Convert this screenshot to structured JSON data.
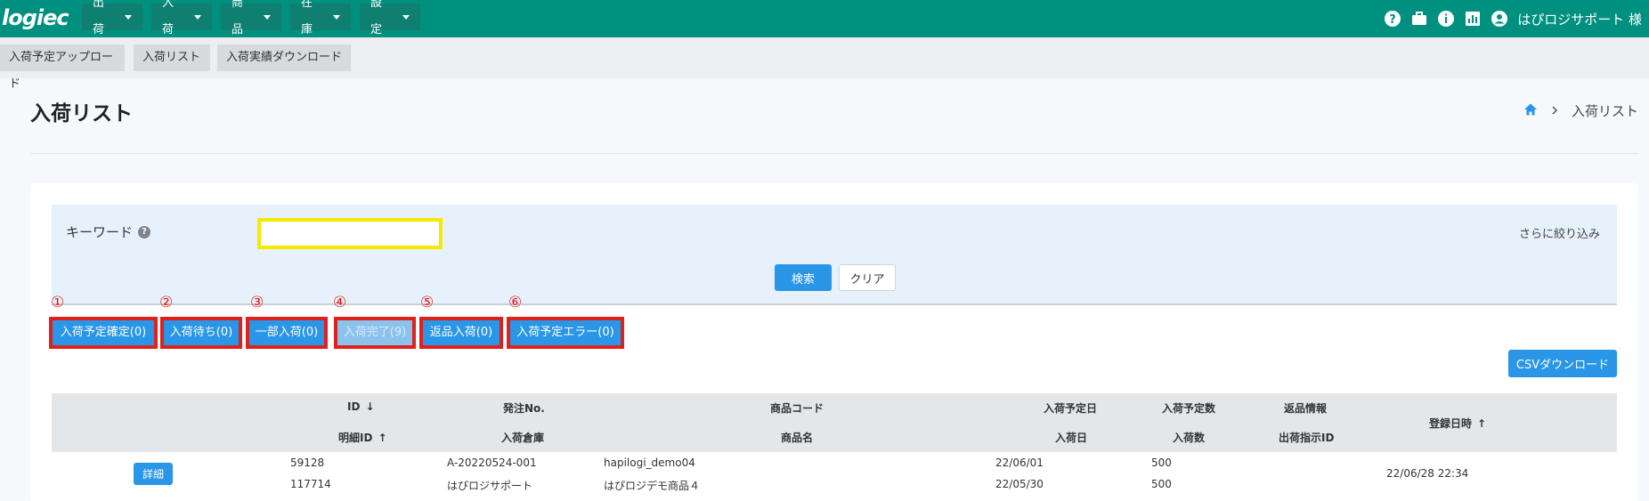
{
  "header": {
    "logo": "logiec",
    "menus": [
      {
        "label": "出荷"
      },
      {
        "label": "入荷"
      },
      {
        "label": "商品"
      },
      {
        "label": "在庫"
      },
      {
        "label": "設定"
      }
    ],
    "user": "はぴロジサポート 様",
    "icons": [
      "help-icon",
      "briefcase-icon",
      "info-icon",
      "chart-icon",
      "account-icon"
    ]
  },
  "subnav": {
    "tabs": [
      {
        "label": "入荷予定アップロード"
      },
      {
        "label": "入荷リスト"
      },
      {
        "label": "入荷実績ダウンロード"
      }
    ]
  },
  "page": {
    "title": "入荷リスト",
    "breadcrumb": "入荷リスト"
  },
  "search": {
    "keyword_label": "キーワード",
    "keyword_value": "",
    "more_filters": "さらに絞り込み",
    "search_button": "検索",
    "clear_button": "クリア"
  },
  "status_filters": [
    {
      "num": "①",
      "label": "入荷予定確定(0)"
    },
    {
      "num": "②",
      "label": "入荷待ち(0)"
    },
    {
      "num": "③",
      "label": "一部入荷(0)"
    },
    {
      "num": "④",
      "label": "入荷完了(9)"
    },
    {
      "num": "⑤",
      "label": "返品入荷(0)"
    },
    {
      "num": "⑥",
      "label": "入荷予定エラー(0)"
    }
  ],
  "csv_button": "CSVダウンロード",
  "table": {
    "headers": {
      "id": "ID",
      "detail_id": "明細ID",
      "order_no": "発注No.",
      "warehouse": "入荷倉庫",
      "product_code": "商品コード",
      "product_name": "商品名",
      "scheduled_date": "入荷予定日",
      "received_date": "入荷日",
      "scheduled_qty": "入荷予定数",
      "received_qty": "入荷数",
      "return_info": "返品情報",
      "shipment_id": "出荷指示ID",
      "registered_at": "登録日時"
    },
    "rows": [
      {
        "detail_button": "詳細",
        "id": "59128",
        "detail_id": "117714",
        "order_no": "A-20220524-001",
        "warehouse": "はぴロジサポート",
        "product_code": "hapilogi_demo04",
        "product_name": "はぴロジデモ商品４",
        "scheduled_date": "22/06/01",
        "received_date": "22/05/30",
        "scheduled_qty": "500",
        "received_qty": "500",
        "registered_at": "22/06/28 22:34"
      }
    ]
  },
  "colors": {
    "header": "#00907f",
    "primary": "#2996e8",
    "highlight_red": "#e0201a",
    "highlight_yellow": "#f5e900"
  }
}
